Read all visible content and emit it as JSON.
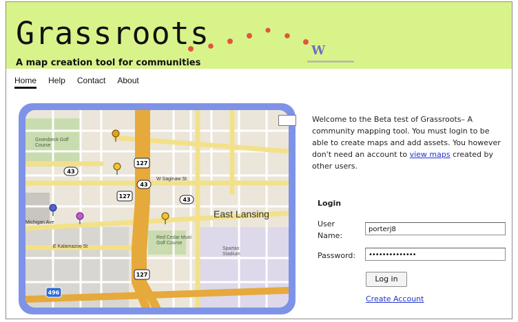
{
  "header": {
    "title": "Grassroots",
    "tagline": "A map creation tool for communities",
    "partner_logo_icon": "w-partner-logo",
    "banner_color": "#d9f38b",
    "dot_color": "#e0563b"
  },
  "nav": {
    "items": [
      {
        "label": "Home",
        "active": true
      },
      {
        "label": "Help",
        "active": false
      },
      {
        "label": "Contact",
        "active": false
      },
      {
        "label": "About",
        "active": false
      }
    ]
  },
  "map": {
    "frame_color": "#7e93e8",
    "city_label": "East Lansing",
    "street_labels": [
      "W Saginaw St",
      "Michigan Ave",
      "E Kalamazoo St"
    ],
    "poi_labels": [
      "Groesbeck Golf Course",
      "Red Cedar Muni Golf Course",
      "Spartan Stadium"
    ],
    "route_shields": [
      "43",
      "127",
      "43",
      "127",
      "43",
      "127"
    ],
    "highway_shield": "496",
    "marker_icons": [
      "map-pin-icon"
    ]
  },
  "welcome": {
    "text_before_link": "Welcome to the Beta test of Grassroots– A community mapping tool. You must login to be able to create maps and add assets. You however don't need an account to ",
    "link_text": "view maps",
    "text_after_link": " created by other users."
  },
  "login": {
    "heading": "Login",
    "username_label": "User Name:",
    "username_value": "porterj8",
    "password_label": "Password:",
    "password_value": "••••••••••••••",
    "login_button": "Log in",
    "create_account_link": "Create Account"
  }
}
